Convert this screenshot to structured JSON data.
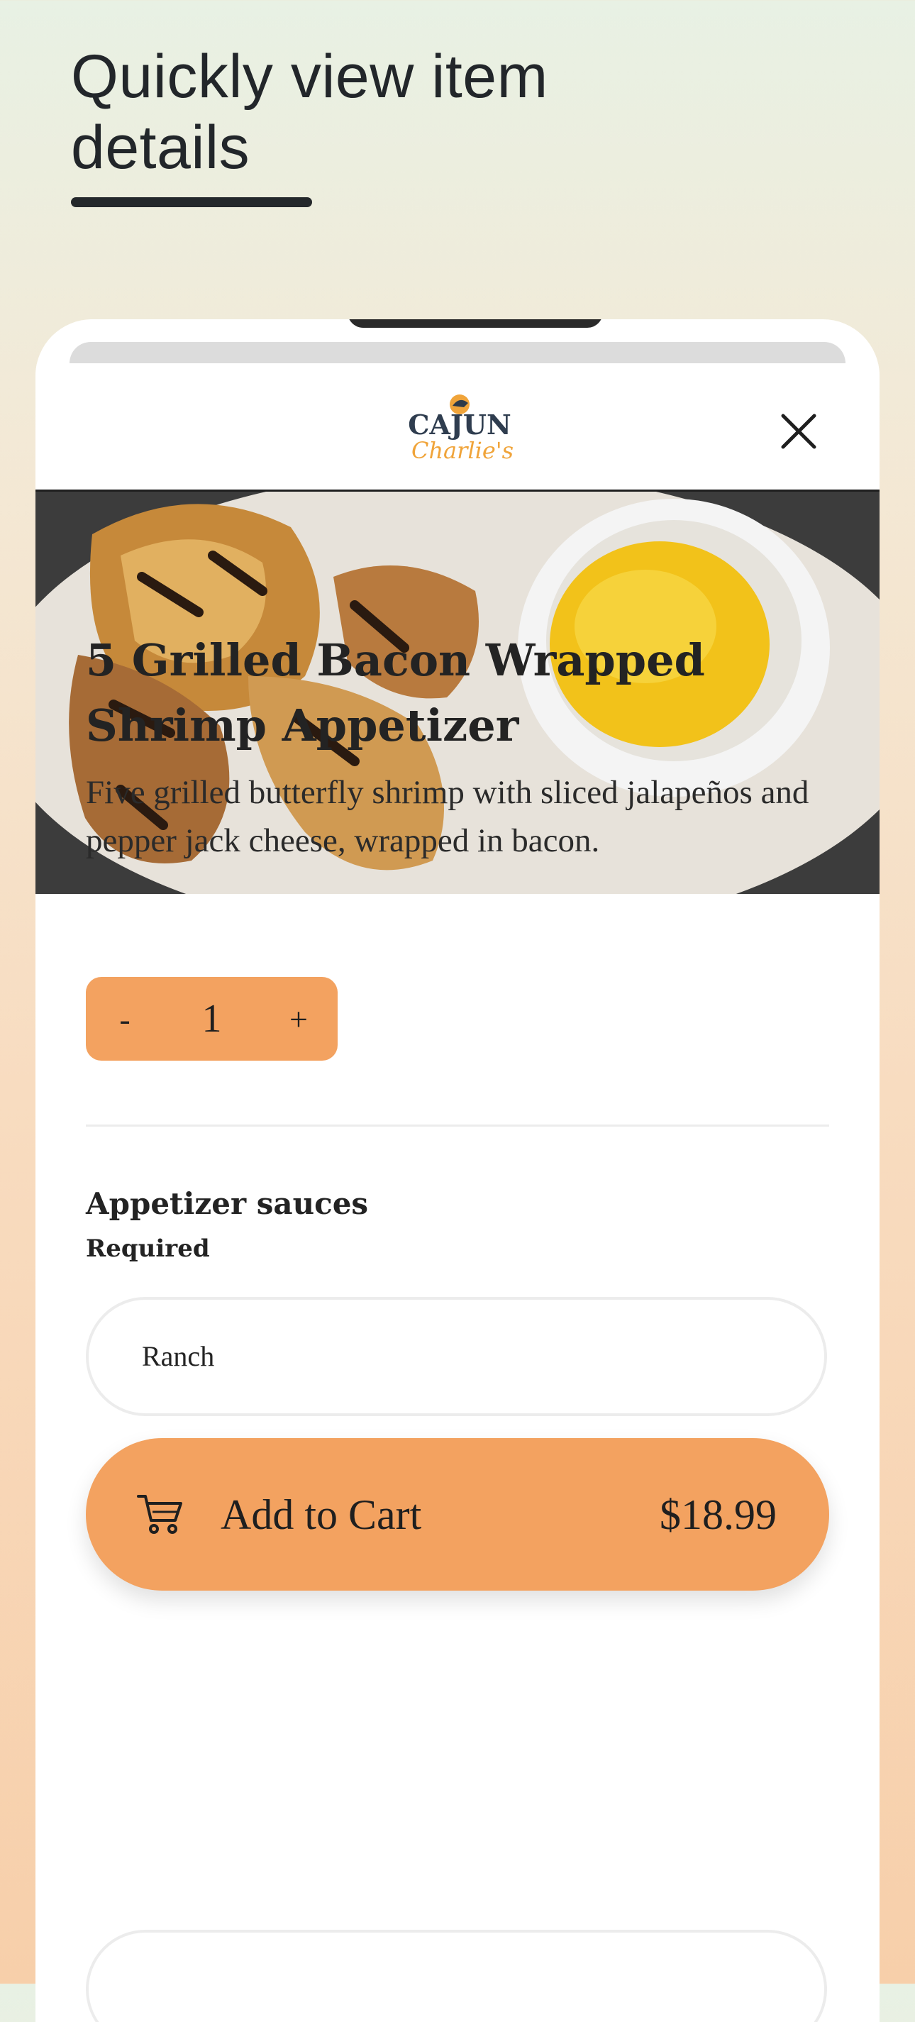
{
  "promo": {
    "headline": "Quickly view item details"
  },
  "header": {
    "logo_text_top": "CAJUN",
    "logo_text_bottom": "Charlie's"
  },
  "item": {
    "title": "5 Grilled Bacon Wrapped Shrimp Appetizer",
    "description": "Five grilled butterfly shrimp with sliced jalapeños and pepper jack cheese, wrapped in bacon."
  },
  "quantity": {
    "minus_label": "-",
    "value": "1",
    "plus_label": "+"
  },
  "options_group": {
    "title": "Appetizer sauces",
    "requirement": "Required",
    "options": [
      {
        "label": "Ranch"
      }
    ]
  },
  "cart": {
    "label": "Add to Cart",
    "price": "$18.99"
  },
  "colors": {
    "accent": "#f3a260",
    "text": "#232323"
  }
}
